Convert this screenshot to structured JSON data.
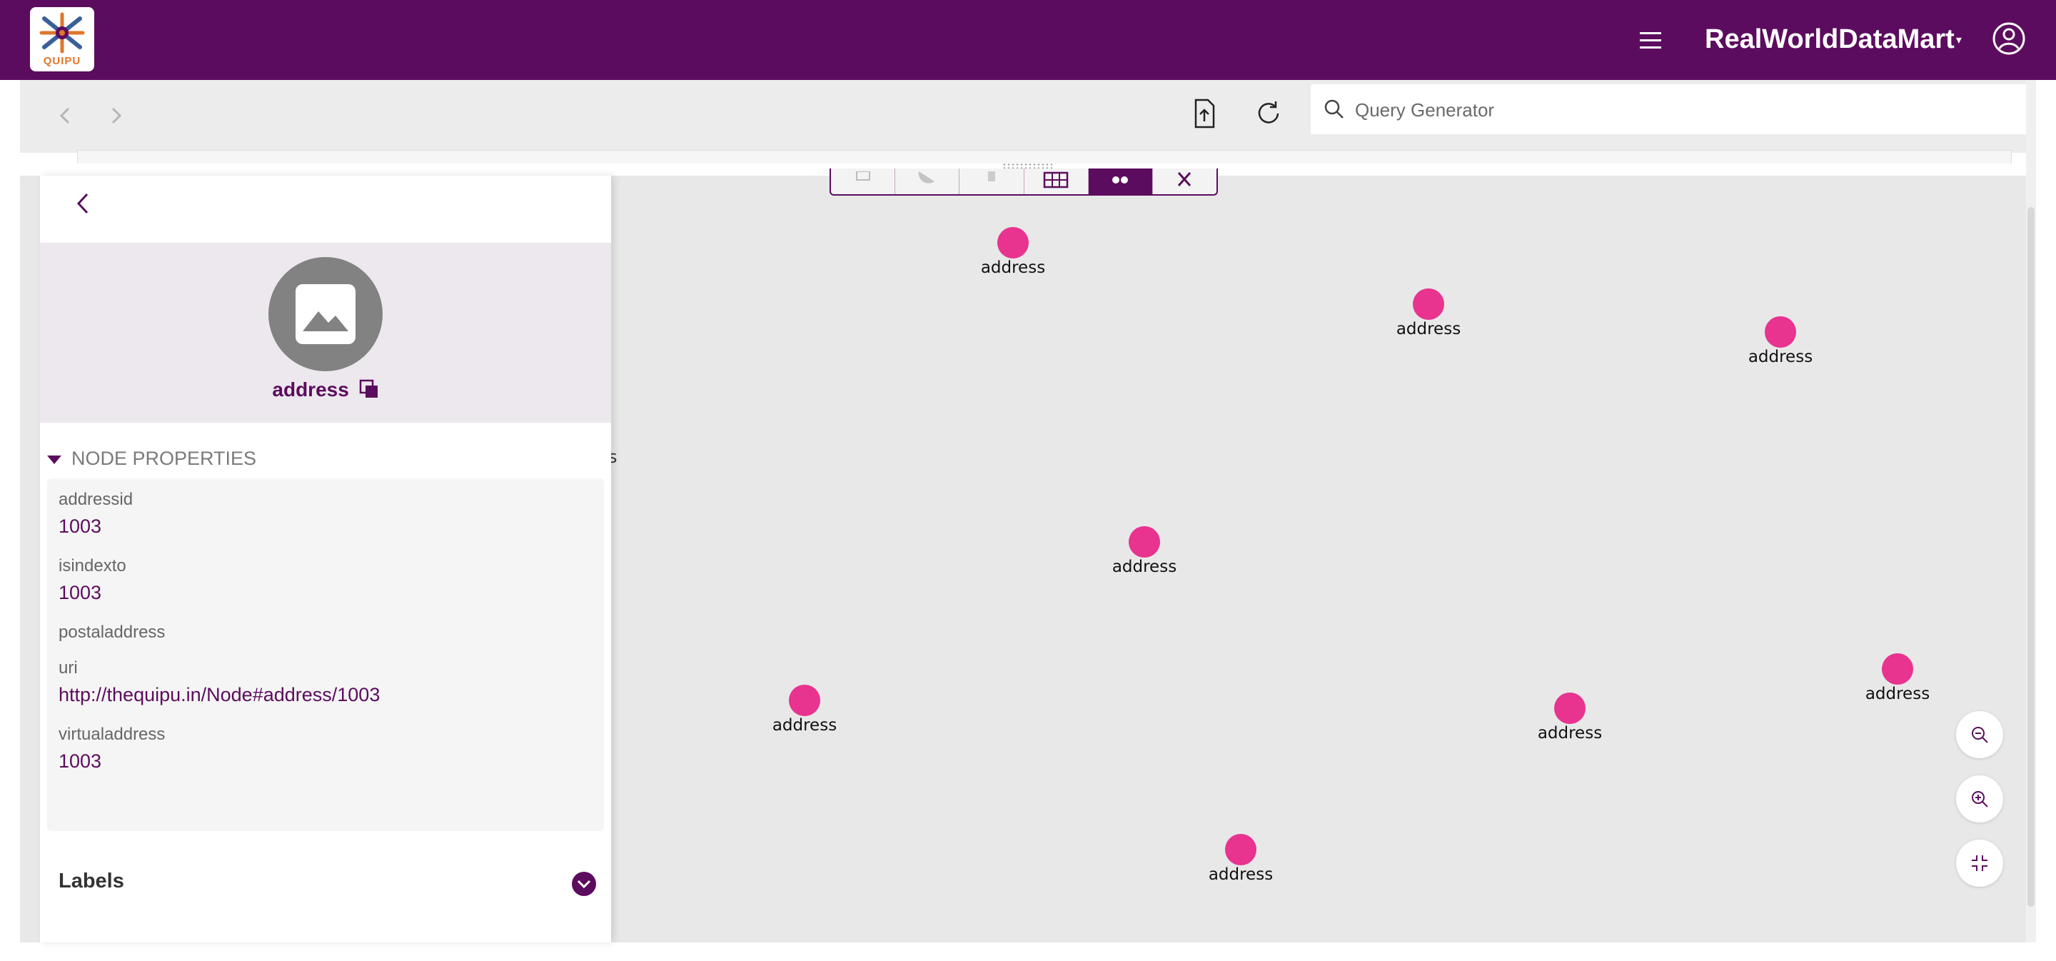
{
  "header": {
    "logo_text": "QUIPU",
    "brand": "RealWorldDataMart",
    "brand_caret": "▾"
  },
  "toolbar": {
    "search_placeholder": "Query Generator"
  },
  "graph": {
    "node_label": "address",
    "stray_text": "s",
    "nodes": [
      {
        "label": "address"
      },
      {
        "label": "address"
      },
      {
        "label": "address"
      },
      {
        "label": "address"
      },
      {
        "label": "address"
      },
      {
        "label": "address"
      },
      {
        "label": "address"
      },
      {
        "label": "address"
      }
    ]
  },
  "panel": {
    "title": "address",
    "section_title": "NODE PROPERTIES",
    "properties": [
      {
        "key": "addressid",
        "value": "1003"
      },
      {
        "key": "isindexto",
        "value": "1003"
      },
      {
        "key": "postaladdress",
        "value": ""
      },
      {
        "key": "uri",
        "value": "http://thequipu.in/Node#address/1003"
      },
      {
        "key": "virtualaddress",
        "value": "1003"
      }
    ],
    "labels_title": "Labels"
  },
  "colors": {
    "brand": "#5c0c5e",
    "node": "#e8338f",
    "canvas": "#e8e8e8"
  }
}
